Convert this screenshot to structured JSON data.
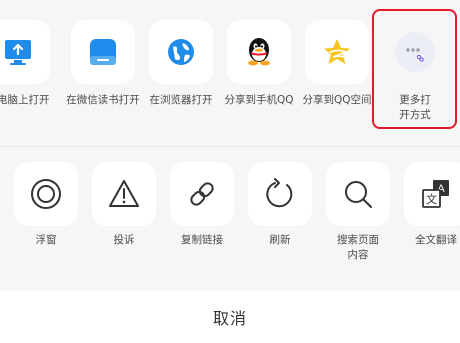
{
  "share_targets": [
    {
      "label": "在电脑上打开",
      "icon": "computer-icon"
    },
    {
      "label": "在微信读书打开",
      "icon": "wechat-read-icon"
    },
    {
      "label": "在浏览器打开",
      "icon": "browser-icon"
    },
    {
      "label": "分享到手机QQ",
      "icon": "qq-icon"
    },
    {
      "label": "分享到QQ空间",
      "icon": "qzone-icon"
    },
    {
      "label": "更多打开方式",
      "icon": "more-apps-icon"
    }
  ],
  "actions": [
    {
      "label": "浮窗",
      "icon": "float-window-icon"
    },
    {
      "label": "投诉",
      "icon": "warning-icon"
    },
    {
      "label": "复制链接",
      "icon": "link-icon"
    },
    {
      "label": "刷新",
      "icon": "refresh-icon"
    },
    {
      "label": "搜索页面内容",
      "icon": "search-icon"
    },
    {
      "label": "全文翻译",
      "icon": "translate-icon"
    }
  ],
  "cancel_label": "取消",
  "colors": {
    "accent_blue": "#1f8ceb",
    "highlight_red": "#e8192b",
    "qzone_yellow": "#f7c41b"
  }
}
